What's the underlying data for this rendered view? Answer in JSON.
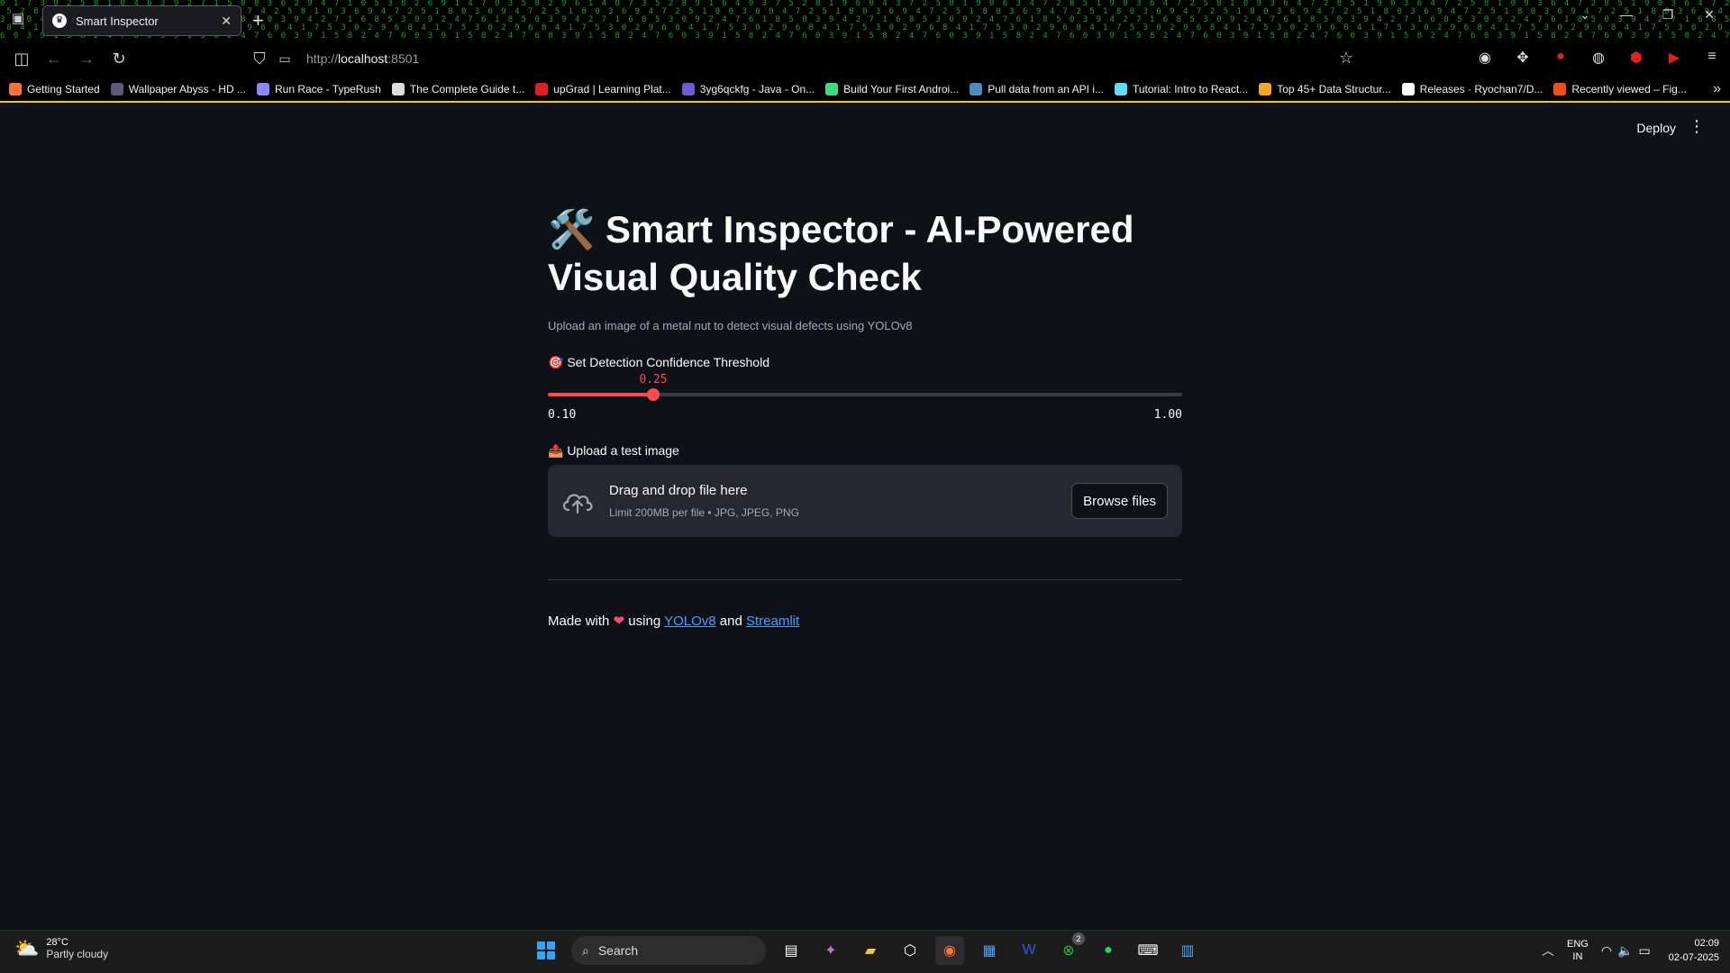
{
  "browser": {
    "tab_title": "Smart Inspector",
    "url_prefix": "http://",
    "url_host": "localhost",
    "url_suffix": ":8501",
    "bookmarks": [
      {
        "label": "Getting Started",
        "color": "#ff7139"
      },
      {
        "label": "Wallpaper Abyss - HD ...",
        "color": "#5a5a7a"
      },
      {
        "label": "Run Race - TypeRush",
        "color": "#8888ff"
      },
      {
        "label": "The Complete Guide t...",
        "color": "#dddddd"
      },
      {
        "label": "upGrad | Learning Plat...",
        "color": "#e02020"
      },
      {
        "label": "3yg6qckfg - Java - On...",
        "color": "#6b5bd6"
      },
      {
        "label": "Build Your First Androi...",
        "color": "#3ddc84"
      },
      {
        "label": "Pull data from an API i...",
        "color": "#4b8bbe"
      },
      {
        "label": "Tutorial: Intro to React...",
        "color": "#61dafb"
      },
      {
        "label": "Top 45+ Data Structur...",
        "color": "#f5a623"
      },
      {
        "label": "Releases · Ryochan7/D...",
        "color": "#ffffff"
      },
      {
        "label": "Recently viewed – Fig...",
        "color": "#f24e1e"
      }
    ]
  },
  "app": {
    "deploy_label": "Deploy",
    "title": "🛠️ Smart Inspector - AI-Powered Visual Quality Check",
    "caption": "Upload an image of a metal nut to detect visual defects using YOLOv8",
    "slider": {
      "label": "🎯 Set Detection Confidence Threshold",
      "value": 0.25,
      "value_label": "0.25",
      "min": 0.1,
      "max": 1.0,
      "min_label": "0.10",
      "max_label": "1.00",
      "accent": "#ff4b4b"
    },
    "uploader": {
      "label": "📤 Upload a test image",
      "title": "Drag and drop file here",
      "limit": "Limit 200MB per file • JPG, JPEG, PNG",
      "button": "Browse files"
    },
    "footer": {
      "prefix": "Made with",
      "heart": "❤",
      "using": "using",
      "link1": "YOLOv8",
      "and": "and",
      "link2": "Streamlit"
    }
  },
  "taskbar": {
    "temp": "28°C",
    "weather": "Partly cloudy",
    "search_label": "Search",
    "xbox_badge": "2",
    "lang_top": "ENG",
    "lang_bottom": "IN",
    "time": "02:09",
    "date": "02-07-2025"
  }
}
